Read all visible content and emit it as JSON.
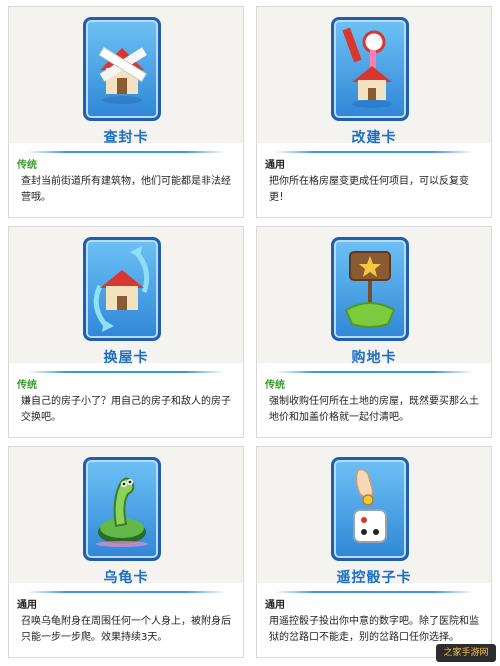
{
  "cards": [
    {
      "name": "查封卡",
      "tag": "传统",
      "tag_color": "#3b9a2d",
      "description": "查封当前街道所有建筑物，他们可能都是非法经营哦。",
      "icon": "sealed-house-icon"
    },
    {
      "name": "改建卡",
      "tag": "通用",
      "tag_color": "#222222",
      "description": "把你所在格房屋变更成任何项目，可以反复变更！",
      "icon": "rebuild-house-icon"
    },
    {
      "name": "换屋卡",
      "tag": "传统",
      "tag_color": "#3b9a2d",
      "description": "嫌自己的房子小了？用自己的房子和敌人的房子交换吧。",
      "icon": "swap-house-icon"
    },
    {
      "name": "购地卡",
      "tag": "传统",
      "tag_color": "#3b9a2d",
      "description": "强制收购任何所在土地的房屋，既然要买那么土地价和加盖价格就一起付清吧。",
      "icon": "land-sign-icon"
    },
    {
      "name": "乌龟卡",
      "tag": "通用",
      "tag_color": "#222222",
      "description": "召唤乌龟附身在周围任何一个人身上，被附身后只能一步一步爬。效果持续3天。",
      "icon": "turtle-icon"
    },
    {
      "name": "遥控骰子卡",
      "tag": "通用",
      "tag_color": "#222222",
      "description": "用遥控骰子投出你中意的数字吧。除了医院和监狱的岔路口不能走，别的岔路口任你选择。",
      "icon": "remote-dice-icon"
    }
  ],
  "watermark": "之家手游网",
  "colors": {
    "card_blue": "#2f87d6",
    "name_blue": "#1e6fc4",
    "tag_green": "#3b9a2d"
  }
}
